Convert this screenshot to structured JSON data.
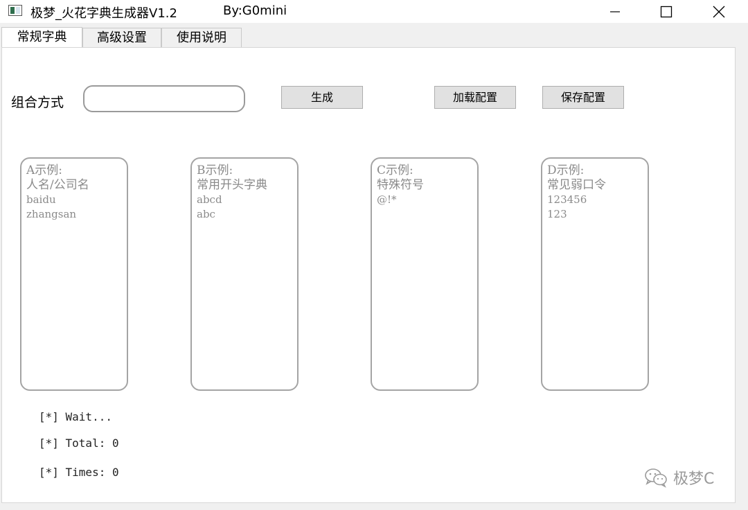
{
  "window": {
    "title": "极梦_火花字典生成器V1.2",
    "author": "By:G0mini",
    "controls": {
      "minimize_icon": "minimize-icon",
      "maximize_icon": "maximize-icon",
      "close_icon": "close-icon"
    }
  },
  "tabs": [
    {
      "label": "常规字典",
      "active": true
    },
    {
      "label": "高级设置",
      "active": false
    },
    {
      "label": "使用说明",
      "active": false
    }
  ],
  "combo": {
    "label": "组合方式",
    "value": ""
  },
  "buttons": {
    "generate": "生成",
    "load_config": "加载配置",
    "save_config": "保存配置"
  },
  "boxes": [
    {
      "lines": [
        "A示例:",
        "人名/公司名",
        "baidu",
        "zhangsan"
      ]
    },
    {
      "lines": [
        "B示例:",
        "常用开头字典",
        "abcd",
        "abc"
      ]
    },
    {
      "lines": [
        "C示例:",
        "特殊符号",
        "@!*"
      ]
    },
    {
      "lines": [
        "D示例:",
        "常见弱口令",
        "123456",
        "123"
      ]
    }
  ],
  "status": {
    "wait": "[*] Wait...",
    "total": "[*] Total: 0",
    "times": "[*] Times: 0"
  },
  "watermark": {
    "text": "极梦C",
    "icon": "wechat-icon"
  },
  "colors": {
    "panel_bg": "#ffffff",
    "window_bg": "#f0f0f0",
    "placeholder_text": "#8a8a8a"
  }
}
